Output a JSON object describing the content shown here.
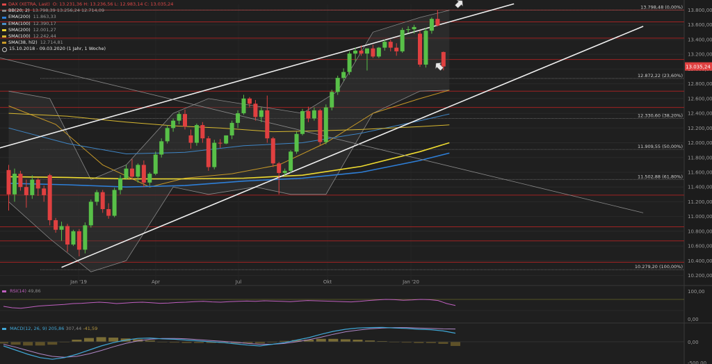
{
  "legend": {
    "main": {
      "label": "DAX (XETRA, Last)",
      "values": "O: 13.231,36  H: 13.236,56  L: 12.983,14  C: 13.035,24",
      "color": "#e04848"
    },
    "bb": {
      "label": "BB(20; 2)",
      "values": "13.798,39  13.256,24  12.714,09",
      "color": "#888888"
    },
    "ema200": {
      "label": "EMA(200)",
      "values": "11.863,33",
      "color": "#2e7fd8"
    },
    "ema100": {
      "label": "EMA(100)",
      "values": "12.390,17",
      "color": "#4a90c8"
    },
    "sma200": {
      "label": "SMA(200)",
      "values": "12.001,27",
      "color": "#e8d030"
    },
    "sma100": {
      "label": "SMA(100)",
      "values": "12.242,44",
      "color": "#d8b830"
    },
    "sma38": {
      "label": "SMA(38, hl2)",
      "values": "12.714,81",
      "color": "#c89a28"
    },
    "range": "15.10.2018 - 09.03.2020  (1 Jahr, 1 Woche)"
  },
  "rsi": {
    "label": "RSI(14)",
    "value": "49,86",
    "color": "#c060c0"
  },
  "macd": {
    "label": "MACD(12, 26, 9)",
    "v1": "205,86",
    "v2": "307,44",
    "v3": "-41,59"
  },
  "price_badge": "13.035,24",
  "chart_data": {
    "type": "candlestick",
    "x_labels": [
      "Jan '19",
      "Apr",
      "Jul",
      "Okt",
      "Jan '20"
    ],
    "y_ticks": [
      10200,
      10400,
      10600,
      10800,
      11000,
      11200,
      11400,
      11600,
      11800,
      12000,
      12200,
      12400,
      12600,
      12800,
      13000,
      13200,
      13400,
      13600,
      13800
    ],
    "ylim": [
      10130,
      13880
    ],
    "rsi_ticks": [
      "100,00",
      "0,00"
    ],
    "macd_ticks": [
      "0,00",
      "-500,00"
    ],
    "fib_levels": [
      {
        "value": 13798.48,
        "label": "13.798,48 (0,00%)"
      },
      {
        "value": 12872.22,
        "label": "12.872,22 (23,60%)"
      },
      {
        "value": 12330.6,
        "label": "12.330,60 (38,20%)"
      },
      {
        "value": 11909.55,
        "label": "11.909,55 (50,00%)"
      },
      {
        "value": 11502.88,
        "label": "11.502,88 (61,80%)"
      },
      {
        "value": 10279.2,
        "label": "10.279,20 (100,00%)"
      }
    ],
    "red_lines": [
      13800,
      13640,
      13420,
      13130,
      12700,
      12480,
      11290,
      10860,
      10670,
      10380
    ],
    "candles": [
      {
        "o": 11630,
        "h": 11700,
        "l": 11080,
        "c": 11300
      },
      {
        "o": 11300,
        "h": 11650,
        "l": 11200,
        "c": 11580
      },
      {
        "o": 11580,
        "h": 11620,
        "l": 11350,
        "c": 11400
      },
      {
        "o": 11400,
        "h": 11500,
        "l": 11120,
        "c": 11290
      },
      {
        "o": 11290,
        "h": 11560,
        "l": 11240,
        "c": 11500
      },
      {
        "o": 11500,
        "h": 11520,
        "l": 11280,
        "c": 11380
      },
      {
        "o": 11380,
        "h": 11420,
        "l": 11200,
        "c": 11290
      },
      {
        "o": 11560,
        "h": 11580,
        "l": 10880,
        "c": 10950
      },
      {
        "o": 10950,
        "h": 10980,
        "l": 10780,
        "c": 10820
      },
      {
        "o": 10820,
        "h": 10930,
        "l": 10670,
        "c": 10870
      },
      {
        "o": 10870,
        "h": 10900,
        "l": 10520,
        "c": 10620
      },
      {
        "o": 10620,
        "h": 10820,
        "l": 10600,
        "c": 10800
      },
      {
        "o": 10800,
        "h": 10830,
        "l": 10460,
        "c": 10550
      },
      {
        "o": 10550,
        "h": 10920,
        "l": 10500,
        "c": 10880
      },
      {
        "o": 10880,
        "h": 11230,
        "l": 10850,
        "c": 11200
      },
      {
        "o": 11200,
        "h": 11360,
        "l": 11150,
        "c": 11330
      },
      {
        "o": 11330,
        "h": 11360,
        "l": 11050,
        "c": 11100
      },
      {
        "o": 11100,
        "h": 11180,
        "l": 10970,
        "c": 11010
      },
      {
        "o": 11010,
        "h": 11390,
        "l": 10990,
        "c": 11360
      },
      {
        "o": 11360,
        "h": 11560,
        "l": 11300,
        "c": 11520
      },
      {
        "o": 11520,
        "h": 11700,
        "l": 11500,
        "c": 11650
      },
      {
        "o": 11650,
        "h": 11780,
        "l": 11500,
        "c": 11540
      },
      {
        "o": 11540,
        "h": 11720,
        "l": 11460,
        "c": 11700
      },
      {
        "o": 11700,
        "h": 11760,
        "l": 11400,
        "c": 11460
      },
      {
        "o": 11460,
        "h": 11600,
        "l": 11420,
        "c": 11580
      },
      {
        "o": 11580,
        "h": 11880,
        "l": 11560,
        "c": 11840
      },
      {
        "o": 11840,
        "h": 12060,
        "l": 11800,
        "c": 12020
      },
      {
        "o": 12020,
        "h": 12240,
        "l": 11990,
        "c": 12200
      },
      {
        "o": 12200,
        "h": 12330,
        "l": 12150,
        "c": 12300
      },
      {
        "o": 12300,
        "h": 12420,
        "l": 12250,
        "c": 12390
      },
      {
        "o": 12390,
        "h": 12450,
        "l": 12180,
        "c": 12220
      },
      {
        "o": 12100,
        "h": 12180,
        "l": 11920,
        "c": 12000
      },
      {
        "o": 12000,
        "h": 12260,
        "l": 11960,
        "c": 12240
      },
      {
        "o": 12240,
        "h": 12280,
        "l": 12000,
        "c": 12060
      },
      {
        "o": 12060,
        "h": 12090,
        "l": 11620,
        "c": 11670
      },
      {
        "o": 11670,
        "h": 12040,
        "l": 11640,
        "c": 12000
      },
      {
        "o": 12000,
        "h": 12050,
        "l": 11930,
        "c": 11990
      },
      {
        "o": 11990,
        "h": 12020,
        "l": 11980,
        "c": 12100
      },
      {
        "o": 12100,
        "h": 12300,
        "l": 12050,
        "c": 12270
      },
      {
        "o": 12270,
        "h": 12440,
        "l": 12200,
        "c": 12400
      },
      {
        "o": 12400,
        "h": 12650,
        "l": 12380,
        "c": 12600
      },
      {
        "o": 12600,
        "h": 12620,
        "l": 12480,
        "c": 12530
      },
      {
        "o": 12530,
        "h": 12580,
        "l": 12300,
        "c": 12350
      },
      {
        "o": 12350,
        "h": 12480,
        "l": 12280,
        "c": 12440
      },
      {
        "o": 12440,
        "h": 12640,
        "l": 12000,
        "c": 12060
      },
      {
        "o": 12060,
        "h": 12080,
        "l": 11670,
        "c": 11720
      },
      {
        "o": 11720,
        "h": 11740,
        "l": 11300,
        "c": 11590
      },
      {
        "o": 11590,
        "h": 11650,
        "l": 11550,
        "c": 11620
      },
      {
        "o": 11620,
        "h": 11900,
        "l": 11590,
        "c": 11880
      },
      {
        "o": 11880,
        "h": 12150,
        "l": 11850,
        "c": 12120
      },
      {
        "o": 12120,
        "h": 12460,
        "l": 12100,
        "c": 12430
      },
      {
        "o": 12430,
        "h": 12490,
        "l": 12280,
        "c": 12330
      },
      {
        "o": 12330,
        "h": 12480,
        "l": 12300,
        "c": 12440
      },
      {
        "o": 12440,
        "h": 12460,
        "l": 11970,
        "c": 12010
      },
      {
        "o": 12010,
        "h": 12520,
        "l": 11980,
        "c": 12480
      },
      {
        "o": 12480,
        "h": 12720,
        "l": 12440,
        "c": 12690
      },
      {
        "o": 12690,
        "h": 12910,
        "l": 12650,
        "c": 12880
      },
      {
        "o": 12880,
        "h": 13010,
        "l": 12840,
        "c": 12960
      },
      {
        "o": 12960,
        "h": 13240,
        "l": 12920,
        "c": 13210
      },
      {
        "o": 13210,
        "h": 13290,
        "l": 13100,
        "c": 13250
      },
      {
        "o": 13250,
        "h": 13320,
        "l": 13180,
        "c": 13210
      },
      {
        "o": 13210,
        "h": 13280,
        "l": 12980,
        "c": 13280
      },
      {
        "o": 13280,
        "h": 13330,
        "l": 13150,
        "c": 13170
      },
      {
        "o": 13170,
        "h": 13300,
        "l": 13150,
        "c": 13290
      },
      {
        "o": 13290,
        "h": 13400,
        "l": 13250,
        "c": 13370
      },
      {
        "o": 13370,
        "h": 13400,
        "l": 13240,
        "c": 13290
      },
      {
        "o": 13290,
        "h": 13350,
        "l": 13180,
        "c": 13240
      },
      {
        "o": 13240,
        "h": 13560,
        "l": 13220,
        "c": 13530
      },
      {
        "o": 13530,
        "h": 13580,
        "l": 13490,
        "c": 13540
      },
      {
        "o": 13540,
        "h": 13600,
        "l": 13480,
        "c": 13570
      },
      {
        "o": 13480,
        "h": 13520,
        "l": 13030,
        "c": 13060
      },
      {
        "o": 13060,
        "h": 13560,
        "l": 13020,
        "c": 13520
      },
      {
        "o": 13520,
        "h": 13700,
        "l": 13480,
        "c": 13680
      },
      {
        "o": 13680,
        "h": 13800,
        "l": 13580,
        "c": 13590
      },
      {
        "o": 13231,
        "h": 13237,
        "l": 12983,
        "c": 13035
      }
    ],
    "overlays": {
      "sma200": [
        [
          0,
          11540
        ],
        [
          10,
          11530
        ],
        [
          20,
          11510
        ],
        [
          30,
          11510
        ],
        [
          40,
          11520
        ],
        [
          50,
          11560
        ],
        [
          60,
          11680
        ],
        [
          70,
          11880
        ],
        [
          75,
          12000
        ]
      ],
      "ema200": [
        [
          0,
          11450
        ],
        [
          10,
          11430
        ],
        [
          20,
          11400
        ],
        [
          30,
          11420
        ],
        [
          40,
          11480
        ],
        [
          50,
          11520
        ],
        [
          60,
          11600
        ],
        [
          70,
          11760
        ],
        [
          75,
          11860
        ]
      ],
      "sma100": [
        [
          0,
          12400
        ],
        [
          10,
          12360
        ],
        [
          20,
          12280
        ],
        [
          28,
          12230
        ],
        [
          36,
          12200
        ],
        [
          45,
          12150
        ],
        [
          52,
          12160
        ],
        [
          60,
          12180
        ],
        [
          70,
          12220
        ],
        [
          75,
          12242
        ]
      ],
      "ema100": [
        [
          0,
          12200
        ],
        [
          10,
          11990
        ],
        [
          20,
          11850
        ],
        [
          30,
          11870
        ],
        [
          40,
          11960
        ],
        [
          50,
          12000
        ],
        [
          60,
          12130
        ],
        [
          70,
          12300
        ],
        [
          75,
          12390
        ]
      ],
      "sma38": [
        [
          0,
          12500
        ],
        [
          8,
          12250
        ],
        [
          16,
          11700
        ],
        [
          24,
          11400
        ],
        [
          30,
          11520
        ],
        [
          38,
          11580
        ],
        [
          46,
          11700
        ],
        [
          54,
          12000
        ],
        [
          62,
          12400
        ],
        [
          70,
          12600
        ],
        [
          75,
          12714
        ]
      ],
      "bb_upper": [
        [
          0,
          12700
        ],
        [
          7,
          12600
        ],
        [
          14,
          11500
        ],
        [
          20,
          11700
        ],
        [
          28,
          12400
        ],
        [
          34,
          12600
        ],
        [
          42,
          12500
        ],
        [
          50,
          12400
        ],
        [
          56,
          12700
        ],
        [
          62,
          13500
        ],
        [
          70,
          13700
        ],
        [
          75,
          13798
        ]
      ],
      "bb_lower": [
        [
          0,
          11200
        ],
        [
          7,
          10700
        ],
        [
          14,
          10250
        ],
        [
          20,
          10400
        ],
        [
          28,
          11400
        ],
        [
          34,
          11300
        ],
        [
          42,
          11400
        ],
        [
          48,
          11300
        ],
        [
          54,
          11300
        ],
        [
          62,
          12400
        ],
        [
          70,
          12700
        ],
        [
          75,
          12714
        ]
      ]
    },
    "trend_lines": [
      {
        "from": [
          -6,
          11830
        ],
        "to": [
          86,
          13885
        ]
      },
      {
        "from": [
          9,
          10310
        ],
        "to": [
          108,
          13580
        ]
      },
      {
        "from": [
          -4,
          13200
        ],
        "to": [
          108,
          11050
        ]
      }
    ],
    "rsi_values": [
      45,
      40,
      38,
      42,
      46,
      48,
      50,
      52,
      55,
      56,
      58,
      60,
      58,
      55,
      57,
      59,
      60,
      58,
      56,
      57,
      59,
      60,
      62,
      63,
      61,
      60,
      62,
      63,
      64,
      63,
      65,
      64,
      63,
      62,
      64,
      66,
      65,
      64,
      63,
      62,
      61,
      63,
      66,
      68,
      70,
      69,
      67,
      68,
      70,
      69,
      66,
      55,
      48
    ],
    "macd_line": [
      -100,
      -200,
      -300,
      -380,
      -420,
      -380,
      -300,
      -200,
      -100,
      -20,
      40,
      80,
      90,
      70,
      60,
      40,
      20,
      0,
      -20,
      -50,
      -80,
      -100,
      -60,
      -20,
      40,
      100,
      180,
      250,
      300,
      330,
      340,
      345,
      330,
      320,
      300,
      290,
      260,
      206
    ],
    "macd_signal": [
      -60,
      -130,
      -210,
      -290,
      -350,
      -370,
      -350,
      -290,
      -210,
      -120,
      -40,
      20,
      60,
      80,
      80,
      70,
      50,
      30,
      10,
      -10,
      -40,
      -60,
      -60,
      -40,
      0,
      50,
      110,
      180,
      240,
      280,
      310,
      330,
      340,
      340,
      330,
      320,
      310,
      307
    ]
  }
}
